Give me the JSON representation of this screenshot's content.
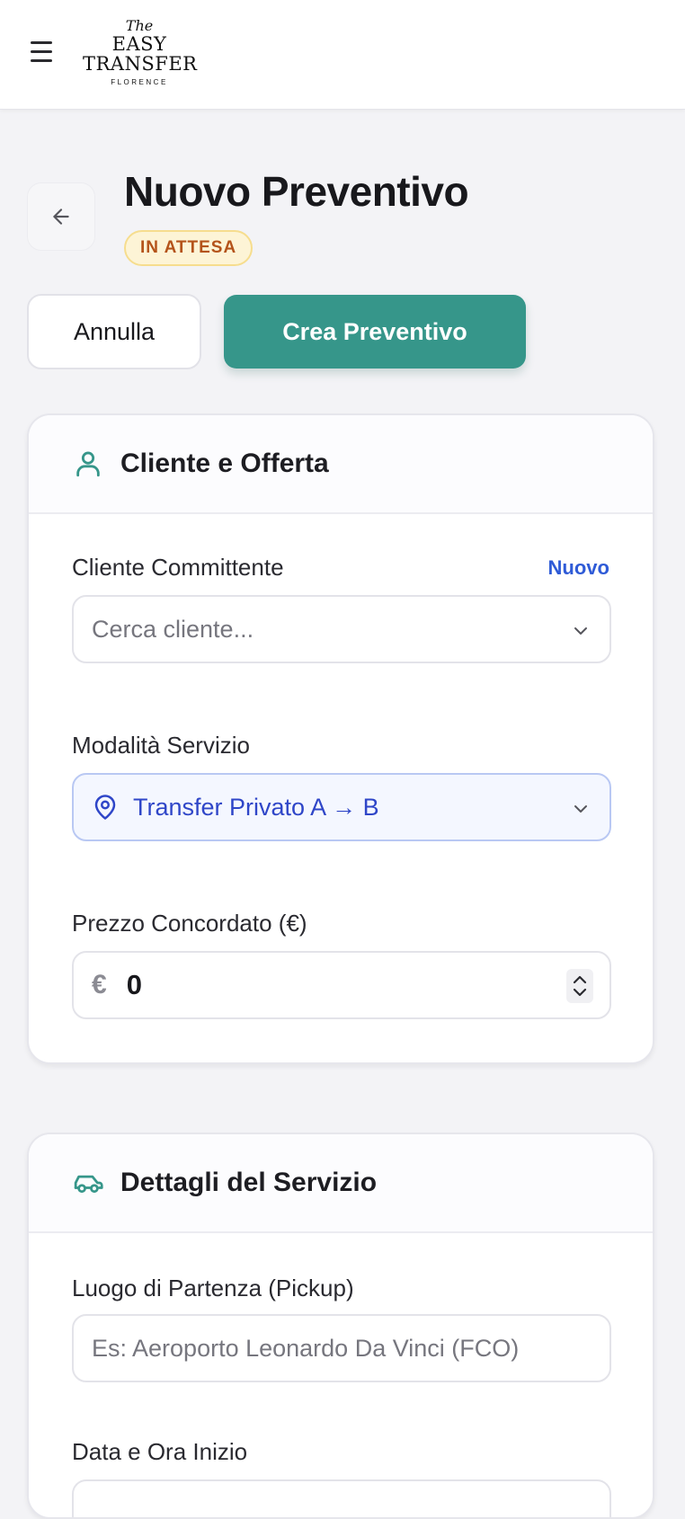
{
  "header": {
    "logo": {
      "the": "The",
      "line1": "EASY",
      "line2": "TRANSFER",
      "line3": "FLORENCE"
    }
  },
  "page": {
    "title": "Nuovo Preventivo",
    "status": "IN ATTESA"
  },
  "actions": {
    "cancel_label": "Annulla",
    "create_label": "Crea Preventivo"
  },
  "client_card": {
    "title": "Cliente e Offerta",
    "client_label": "Cliente Committente",
    "client_new_link": "Nuovo",
    "client_placeholder": "Cerca cliente...",
    "mode_label": "Modalità Servizio",
    "mode_value": "Transfer Privato A → B",
    "price_label": "Prezzo Concordato (€)",
    "price_prefix": "€",
    "price_value": "0"
  },
  "service_card": {
    "title": "Dettagli del Servizio",
    "pickup_label": "Luogo di Partenza (Pickup)",
    "pickup_placeholder": "Es: Aeroporto Leonardo Da Vinci (FCO)",
    "start_label": "Data e Ora Inizio"
  },
  "colors": {
    "accent": "#36968a",
    "link": "#2f5bd7",
    "status_text": "#b4531a",
    "status_bg": "#fdf4d6"
  },
  "icons": {
    "menu": "hamburger-menu-icon",
    "back": "arrow-left-icon",
    "client": "user-icon",
    "service": "car-icon",
    "location": "map-pin-icon",
    "dropdown": "chevron-down-icon",
    "stepper": "up-down-stepper-icon"
  }
}
